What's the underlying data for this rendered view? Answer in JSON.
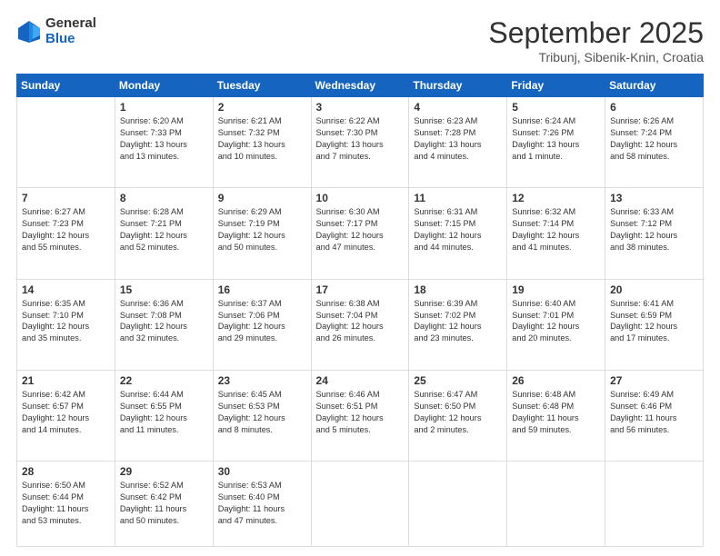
{
  "header": {
    "logo_general": "General",
    "logo_blue": "Blue",
    "month_title": "September 2025",
    "location": "Tribunj, Sibenik-Knin, Croatia"
  },
  "weekdays": [
    "Sunday",
    "Monday",
    "Tuesday",
    "Wednesday",
    "Thursday",
    "Friday",
    "Saturday"
  ],
  "weeks": [
    [
      {
        "day": "",
        "content": ""
      },
      {
        "day": "1",
        "content": "Sunrise: 6:20 AM\nSunset: 7:33 PM\nDaylight: 13 hours\nand 13 minutes."
      },
      {
        "day": "2",
        "content": "Sunrise: 6:21 AM\nSunset: 7:32 PM\nDaylight: 13 hours\nand 10 minutes."
      },
      {
        "day": "3",
        "content": "Sunrise: 6:22 AM\nSunset: 7:30 PM\nDaylight: 13 hours\nand 7 minutes."
      },
      {
        "day": "4",
        "content": "Sunrise: 6:23 AM\nSunset: 7:28 PM\nDaylight: 13 hours\nand 4 minutes."
      },
      {
        "day": "5",
        "content": "Sunrise: 6:24 AM\nSunset: 7:26 PM\nDaylight: 13 hours\nand 1 minute."
      },
      {
        "day": "6",
        "content": "Sunrise: 6:26 AM\nSunset: 7:24 PM\nDaylight: 12 hours\nand 58 minutes."
      }
    ],
    [
      {
        "day": "7",
        "content": "Sunrise: 6:27 AM\nSunset: 7:23 PM\nDaylight: 12 hours\nand 55 minutes."
      },
      {
        "day": "8",
        "content": "Sunrise: 6:28 AM\nSunset: 7:21 PM\nDaylight: 12 hours\nand 52 minutes."
      },
      {
        "day": "9",
        "content": "Sunrise: 6:29 AM\nSunset: 7:19 PM\nDaylight: 12 hours\nand 50 minutes."
      },
      {
        "day": "10",
        "content": "Sunrise: 6:30 AM\nSunset: 7:17 PM\nDaylight: 12 hours\nand 47 minutes."
      },
      {
        "day": "11",
        "content": "Sunrise: 6:31 AM\nSunset: 7:15 PM\nDaylight: 12 hours\nand 44 minutes."
      },
      {
        "day": "12",
        "content": "Sunrise: 6:32 AM\nSunset: 7:14 PM\nDaylight: 12 hours\nand 41 minutes."
      },
      {
        "day": "13",
        "content": "Sunrise: 6:33 AM\nSunset: 7:12 PM\nDaylight: 12 hours\nand 38 minutes."
      }
    ],
    [
      {
        "day": "14",
        "content": "Sunrise: 6:35 AM\nSunset: 7:10 PM\nDaylight: 12 hours\nand 35 minutes."
      },
      {
        "day": "15",
        "content": "Sunrise: 6:36 AM\nSunset: 7:08 PM\nDaylight: 12 hours\nand 32 minutes."
      },
      {
        "day": "16",
        "content": "Sunrise: 6:37 AM\nSunset: 7:06 PM\nDaylight: 12 hours\nand 29 minutes."
      },
      {
        "day": "17",
        "content": "Sunrise: 6:38 AM\nSunset: 7:04 PM\nDaylight: 12 hours\nand 26 minutes."
      },
      {
        "day": "18",
        "content": "Sunrise: 6:39 AM\nSunset: 7:02 PM\nDaylight: 12 hours\nand 23 minutes."
      },
      {
        "day": "19",
        "content": "Sunrise: 6:40 AM\nSunset: 7:01 PM\nDaylight: 12 hours\nand 20 minutes."
      },
      {
        "day": "20",
        "content": "Sunrise: 6:41 AM\nSunset: 6:59 PM\nDaylight: 12 hours\nand 17 minutes."
      }
    ],
    [
      {
        "day": "21",
        "content": "Sunrise: 6:42 AM\nSunset: 6:57 PM\nDaylight: 12 hours\nand 14 minutes."
      },
      {
        "day": "22",
        "content": "Sunrise: 6:44 AM\nSunset: 6:55 PM\nDaylight: 12 hours\nand 11 minutes."
      },
      {
        "day": "23",
        "content": "Sunrise: 6:45 AM\nSunset: 6:53 PM\nDaylight: 12 hours\nand 8 minutes."
      },
      {
        "day": "24",
        "content": "Sunrise: 6:46 AM\nSunset: 6:51 PM\nDaylight: 12 hours\nand 5 minutes."
      },
      {
        "day": "25",
        "content": "Sunrise: 6:47 AM\nSunset: 6:50 PM\nDaylight: 12 hours\nand 2 minutes."
      },
      {
        "day": "26",
        "content": "Sunrise: 6:48 AM\nSunset: 6:48 PM\nDaylight: 11 hours\nand 59 minutes."
      },
      {
        "day": "27",
        "content": "Sunrise: 6:49 AM\nSunset: 6:46 PM\nDaylight: 11 hours\nand 56 minutes."
      }
    ],
    [
      {
        "day": "28",
        "content": "Sunrise: 6:50 AM\nSunset: 6:44 PM\nDaylight: 11 hours\nand 53 minutes."
      },
      {
        "day": "29",
        "content": "Sunrise: 6:52 AM\nSunset: 6:42 PM\nDaylight: 11 hours\nand 50 minutes."
      },
      {
        "day": "30",
        "content": "Sunrise: 6:53 AM\nSunset: 6:40 PM\nDaylight: 11 hours\nand 47 minutes."
      },
      {
        "day": "",
        "content": ""
      },
      {
        "day": "",
        "content": ""
      },
      {
        "day": "",
        "content": ""
      },
      {
        "day": "",
        "content": ""
      }
    ]
  ]
}
